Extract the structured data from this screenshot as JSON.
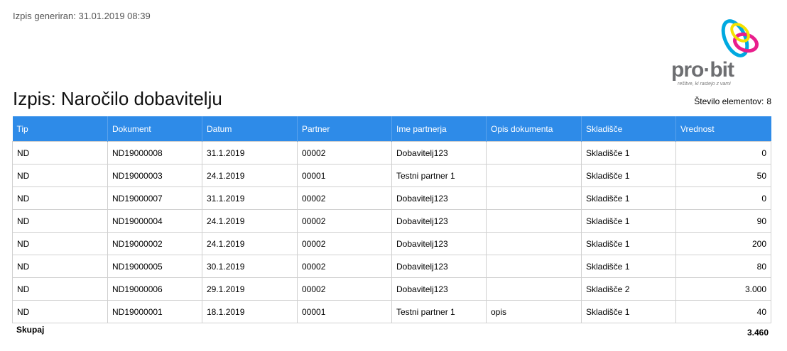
{
  "header": {
    "generated": "Izpis generiran: 31.01.2019 08:39",
    "title": "Izpis: Naročilo dobavitelju",
    "count_label": "Število elementov:",
    "count_value": "8"
  },
  "logo": {
    "brand_left": "pro",
    "brand_dot": "·",
    "brand_right": "bit",
    "slogan": "rešitve, ki rastejo z vami",
    "colors": [
      "#e91e8c",
      "#00a9e0",
      "#f4e100"
    ]
  },
  "table": {
    "columns": [
      "Tip",
      "Dokument",
      "Datum",
      "Partner",
      "Ime partnerja",
      "Opis dokumenta",
      "Skladišče",
      "Vrednost"
    ],
    "rows": [
      [
        "ND",
        "ND19000008",
        "31.1.2019",
        "00002",
        "Dobavitelj123",
        "",
        "Skladišče 1",
        "0"
      ],
      [
        "ND",
        "ND19000003",
        "24.1.2019",
        "00001",
        "Testni partner 1",
        "",
        "Skladišče 1",
        "50"
      ],
      [
        "ND",
        "ND19000007",
        "31.1.2019",
        "00002",
        "Dobavitelj123",
        "",
        "Skladišče 1",
        "0"
      ],
      [
        "ND",
        "ND19000004",
        "24.1.2019",
        "00002",
        "Dobavitelj123",
        "",
        "Skladišče 1",
        "90"
      ],
      [
        "ND",
        "ND19000002",
        "24.1.2019",
        "00002",
        "Dobavitelj123",
        "",
        "Skladišče 1",
        "200"
      ],
      [
        "ND",
        "ND19000005",
        "30.1.2019",
        "00002",
        "Dobavitelj123",
        "",
        "Skladišče 1",
        "80"
      ],
      [
        "ND",
        "ND19000006",
        "29.1.2019",
        "00002",
        "Dobavitelj123",
        "",
        "Skladišče 2",
        "3.000"
      ],
      [
        "ND",
        "ND19000001",
        "18.1.2019",
        "00001",
        "Testni partner 1",
        "opis",
        "Skladišče 1",
        "40"
      ]
    ]
  },
  "footer": {
    "total_label": "Skupaj",
    "total_value": "3.460"
  },
  "colors": {
    "header_bg": "#2e8be8",
    "header_text": "#ffffff",
    "border": "#d0d0d0"
  }
}
